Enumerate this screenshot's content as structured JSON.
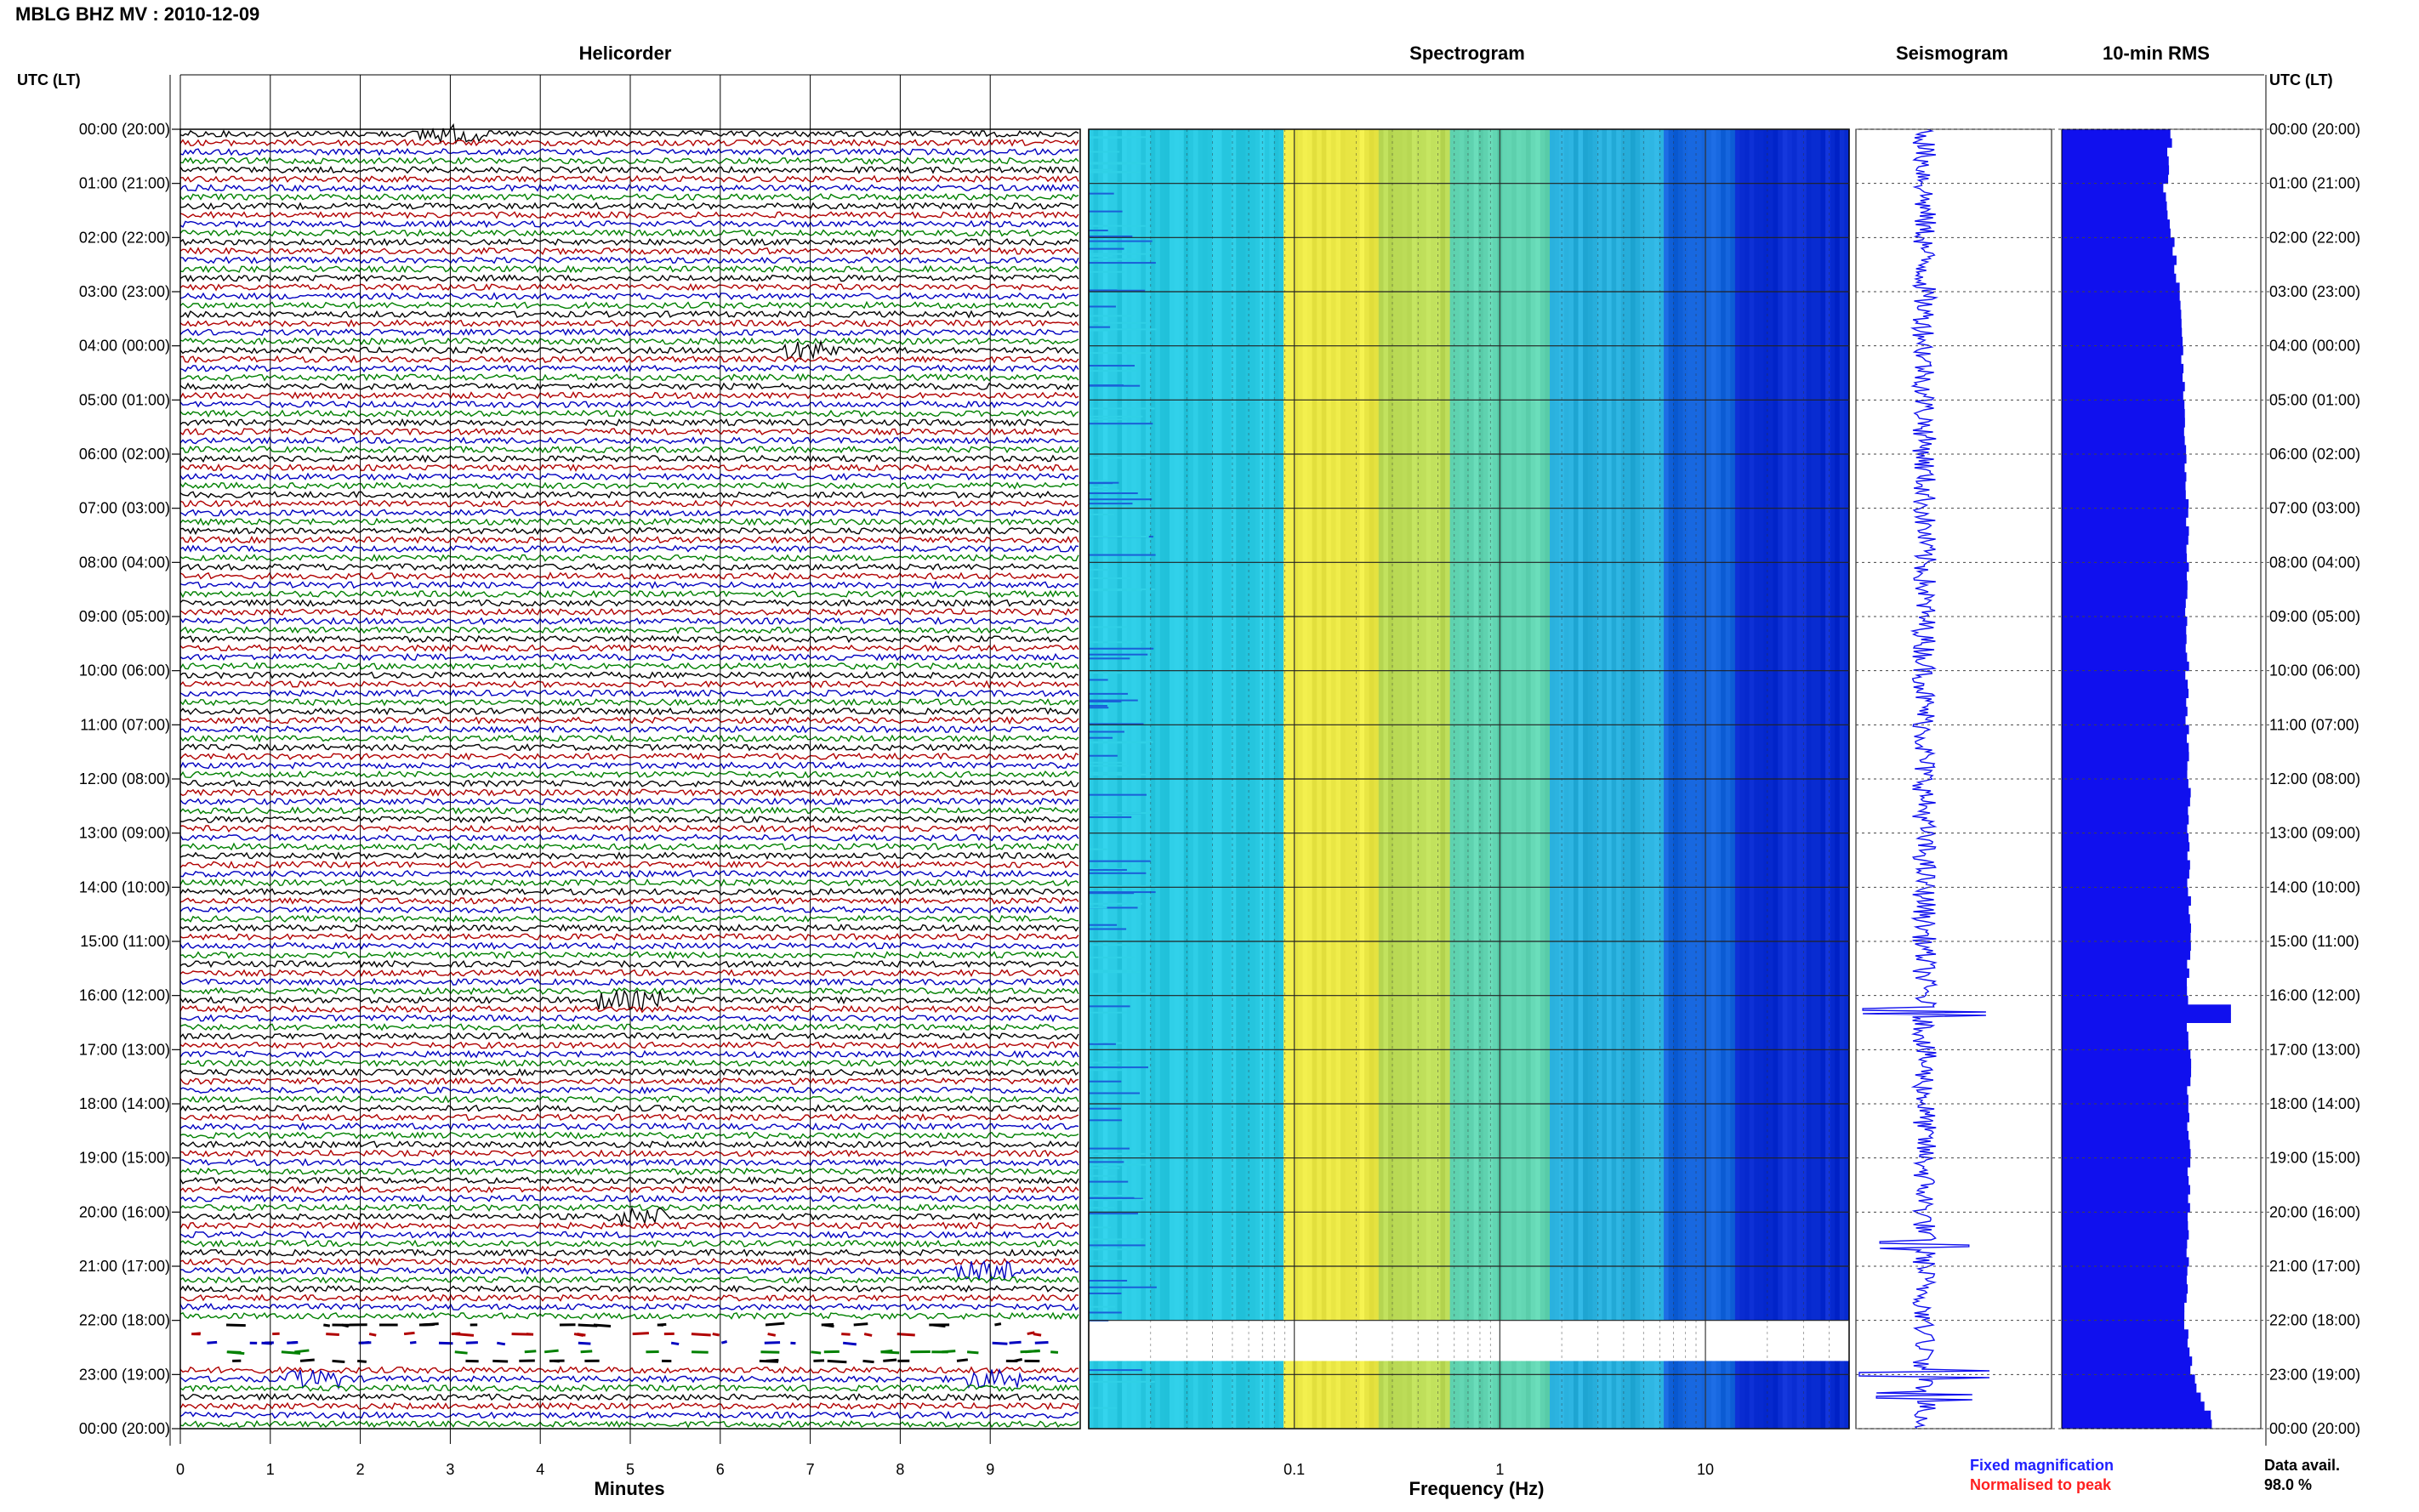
{
  "header": {
    "title": "MBLG BHZ MV : 2010-12-09"
  },
  "panels": {
    "helicorder": {
      "title": "Helicorder",
      "xlabel": "Minutes"
    },
    "spectrogram": {
      "title": "Spectrogram",
      "xlabel": "Frequency (Hz)"
    },
    "seismogram": {
      "title": "Seismogram"
    },
    "rms": {
      "title": "10-min RMS"
    }
  },
  "axis": {
    "left_label": "UTC (LT)",
    "right_label": "UTC (LT)"
  },
  "legend": {
    "fixed": "Fixed magnification",
    "normalised": "Normalised to peak",
    "fixed_color": "#1f1fff",
    "normalised_color": "#ff1f1f"
  },
  "data_availability": {
    "label": "Data avail.",
    "value": "98.0 %"
  },
  "colors": {
    "trace_cycle": [
      "#000000",
      "#b00000",
      "#0000c0",
      "#008000"
    ],
    "rms": "#1010ee",
    "seismogram": "#1010ee"
  },
  "chart_data": [
    {
      "type": "line",
      "title": "Helicorder",
      "xlabel": "Minutes",
      "x_ticks": [
        "0",
        "1",
        "2",
        "3",
        "4",
        "5",
        "6",
        "7",
        "8",
        "9"
      ],
      "xlim": [
        0,
        10
      ],
      "rows_per_hour": 6,
      "y_ticks_utc_lt": [
        "00:00 (20:00)",
        "01:00 (21:00)",
        "02:00 (22:00)",
        "03:00 (23:00)",
        "04:00 (00:00)",
        "05:00 (01:00)",
        "06:00 (02:00)",
        "07:00 (03:00)",
        "08:00 (04:00)",
        "09:00 (05:00)",
        "10:00 (06:00)",
        "11:00 (07:00)",
        "12:00 (08:00)",
        "13:00 (09:00)",
        "14:00 (10:00)",
        "15:00 (11:00)",
        "16:00 (12:00)",
        "17:00 (13:00)",
        "18:00 (14:00)",
        "19:00 (15:00)",
        "20:00 (16:00)",
        "21:00 (17:00)",
        "22:00 (18:00)",
        "23:00 (19:00)",
        "00:00 (20:00)"
      ],
      "events": [
        {
          "hour": 0,
          "minute": 3.0,
          "color": "black"
        },
        {
          "hour": 4,
          "minute": 7.0,
          "color": "green"
        },
        {
          "hour": 16,
          "minute": 5.0,
          "color": "blue"
        },
        {
          "hour": 20,
          "minute": 5.1,
          "color": "green"
        },
        {
          "hour": 21,
          "minute": 8.9,
          "color": "blue"
        },
        {
          "hour": 23,
          "minute": 1.5,
          "color": "red"
        },
        {
          "hour": 23,
          "minute": 9.0,
          "color": "red"
        }
      ],
      "gap": {
        "start_hour": 22.0,
        "end_hour": 22.75
      }
    },
    {
      "type": "heatmap",
      "title": "Spectrogram",
      "xlabel": "Frequency (Hz)",
      "x_scale": "log",
      "x_ticks": [
        "0.1",
        "1",
        "10"
      ],
      "xlim": [
        0.01,
        50
      ],
      "ylim_hours": [
        0,
        24
      ],
      "gap": {
        "start_hour": 22.0,
        "end_hour": 22.75
      }
    },
    {
      "type": "line",
      "title": "Seismogram",
      "spikes": [
        {
          "hour": 16.3,
          "amplitude": 0.9
        },
        {
          "hour": 20.6,
          "amplitude": 0.65
        },
        {
          "hour": 23.0,
          "amplitude": 0.95
        },
        {
          "hour": 23.4,
          "amplitude": 0.7
        }
      ]
    },
    {
      "type": "bar",
      "title": "10-min RMS",
      "orientation": "horizontal",
      "profile_hours": [
        0,
        1,
        2,
        3,
        4,
        5,
        6,
        7,
        8,
        9,
        10,
        11,
        12,
        13,
        14,
        15,
        16,
        17,
        18,
        19,
        20,
        21,
        22,
        23,
        24
      ],
      "profile_values": [
        0.55,
        0.52,
        0.56,
        0.59,
        0.61,
        0.61,
        0.62,
        0.63,
        0.63,
        0.63,
        0.63,
        0.63,
        0.64,
        0.64,
        0.64,
        0.64,
        0.63,
        0.64,
        0.64,
        0.64,
        0.64,
        0.63,
        0.62,
        0.66,
        0.78
      ],
      "peaks": [
        {
          "hour": 16.25,
          "value": 0.85
        }
      ]
    }
  ]
}
